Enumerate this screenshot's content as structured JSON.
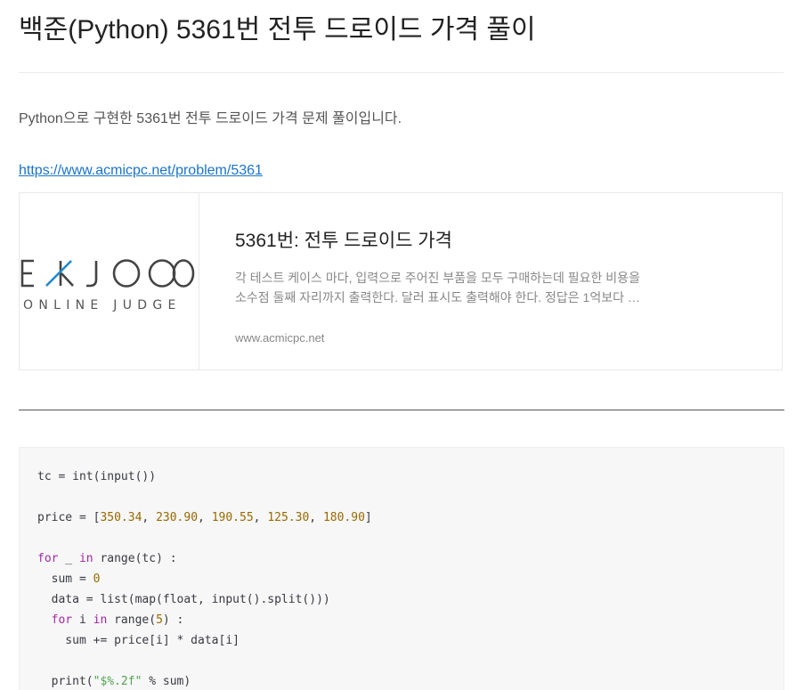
{
  "post": {
    "title": "백준(Python) 5361번 전투 드로이드 가격 풀이",
    "intro": "Python으로 구현한 5361번 전투 드로이드 가격 문제 풀이입니다.",
    "link": "https://www.acmicpc.net/problem/5361"
  },
  "card": {
    "logo_main": "BAEKJOON",
    "logo_sub": "ONLINE JUDGE",
    "title": "5361번: 전투 드로이드 가격",
    "description": "각 테스트 케이스 마다, 입력으로 주어진 부품을 모두 구매하는데 필요한 비용을 소수점 둘째 자리까지 출력한다. 달러 표시도 출력해야 한다. 정답은 1억보다 …",
    "site": "www.acmicpc.net"
  },
  "code": {
    "lines": [
      [
        {
          "t": "tc = int(input())",
          "c": "plain"
        }
      ],
      [],
      [
        {
          "t": "price = [",
          "c": "plain"
        },
        {
          "t": "350.34",
          "c": "num"
        },
        {
          "t": ", ",
          "c": "plain"
        },
        {
          "t": "230.90",
          "c": "num"
        },
        {
          "t": ", ",
          "c": "plain"
        },
        {
          "t": "190.55",
          "c": "num"
        },
        {
          "t": ", ",
          "c": "plain"
        },
        {
          "t": "125.30",
          "c": "num"
        },
        {
          "t": ", ",
          "c": "plain"
        },
        {
          "t": "180.90",
          "c": "num"
        },
        {
          "t": "]",
          "c": "plain"
        }
      ],
      [],
      [
        {
          "t": "for",
          "c": "kw"
        },
        {
          "t": " _ ",
          "c": "plain"
        },
        {
          "t": "in",
          "c": "kw"
        },
        {
          "t": " range(tc) :",
          "c": "plain"
        }
      ],
      [
        {
          "t": "  sum = ",
          "c": "plain"
        },
        {
          "t": "0",
          "c": "num"
        }
      ],
      [
        {
          "t": "  data = list(map(float, input().split()))",
          "c": "plain"
        }
      ],
      [
        {
          "t": "  ",
          "c": "plain"
        },
        {
          "t": "for",
          "c": "kw"
        },
        {
          "t": " i ",
          "c": "plain"
        },
        {
          "t": "in",
          "c": "kw"
        },
        {
          "t": " range(",
          "c": "plain"
        },
        {
          "t": "5",
          "c": "num"
        },
        {
          "t": ") :",
          "c": "plain"
        }
      ],
      [
        {
          "t": "    sum += price[i] * data[i]",
          "c": "plain"
        }
      ],
      [],
      [
        {
          "t": "  print(",
          "c": "plain"
        },
        {
          "t": "\"$%.2f\"",
          "c": "str"
        },
        {
          "t": " % sum)",
          "c": "plain"
        }
      ]
    ]
  },
  "colors": {
    "link": "#1a73c8",
    "keyword": "#a626a4",
    "number": "#986801",
    "string": "#50a14f",
    "logo_blue": "#1e88c9"
  }
}
